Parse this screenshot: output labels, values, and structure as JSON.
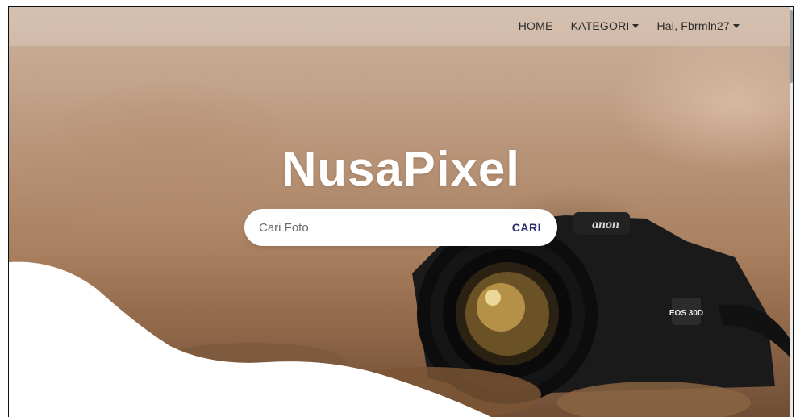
{
  "navbar": {
    "links": [
      {
        "label": "HOME"
      },
      {
        "label": "KATEGORI",
        "dropdown": true
      },
      {
        "label": "Hai, Fbrmln27",
        "dropdown": true
      }
    ]
  },
  "hero": {
    "brand": "NusaPixel",
    "search": {
      "placeholder": "Cari Foto",
      "value": "",
      "button_label": "CARI"
    },
    "image": {
      "camera_brand_text": "anon",
      "model_badge": "EOS 30D"
    }
  },
  "colors": {
    "accent": "#2f2f6b",
    "brand_text": "#ffffff",
    "nav_text": "#2c2c2c"
  }
}
